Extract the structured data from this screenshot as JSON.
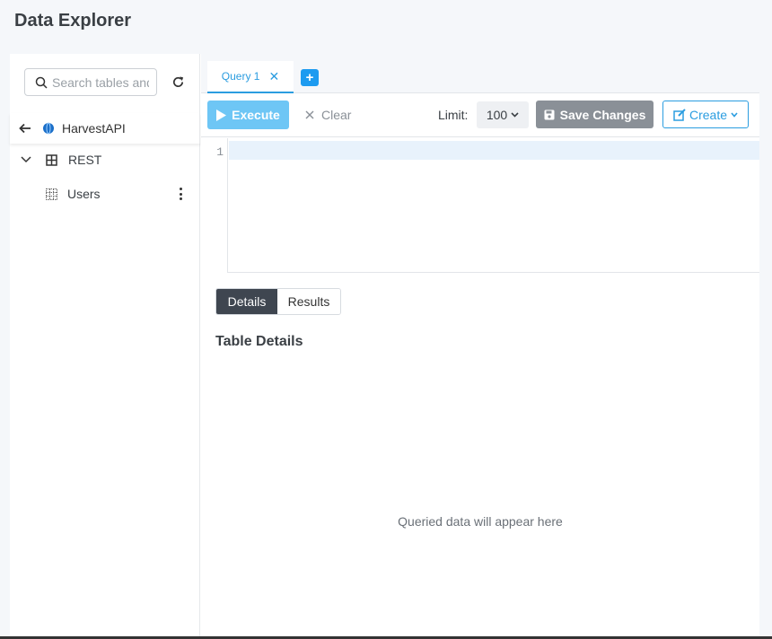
{
  "page": {
    "title": "Data Explorer"
  },
  "sidebar": {
    "search": {
      "placeholder": "Search tables and columns",
      "value": ""
    },
    "datasource": {
      "label": "HarvestAPI"
    },
    "tree": [
      {
        "label": "REST",
        "expanded": true
      },
      {
        "label": "Users"
      }
    ]
  },
  "tabs": [
    {
      "label": "Query 1",
      "active": true
    }
  ],
  "toolbar": {
    "execute_label": "Execute",
    "clear_label": "Clear",
    "limit_label": "Limit:",
    "limit_value": "100",
    "save_label": "Save Changes",
    "create_label": "Create"
  },
  "editor": {
    "line_numbers": [
      "1"
    ],
    "content": ""
  },
  "results": {
    "tabs": [
      "Details",
      "Results"
    ],
    "active_tab": "Details",
    "section_title": "Table Details",
    "empty_message": "Queried data will appear here"
  },
  "colors": {
    "accent": "#2b9de0",
    "execute_bg": "#6ec6f5",
    "save_bg": "#8a9097",
    "details_active_bg": "#3f4650"
  }
}
